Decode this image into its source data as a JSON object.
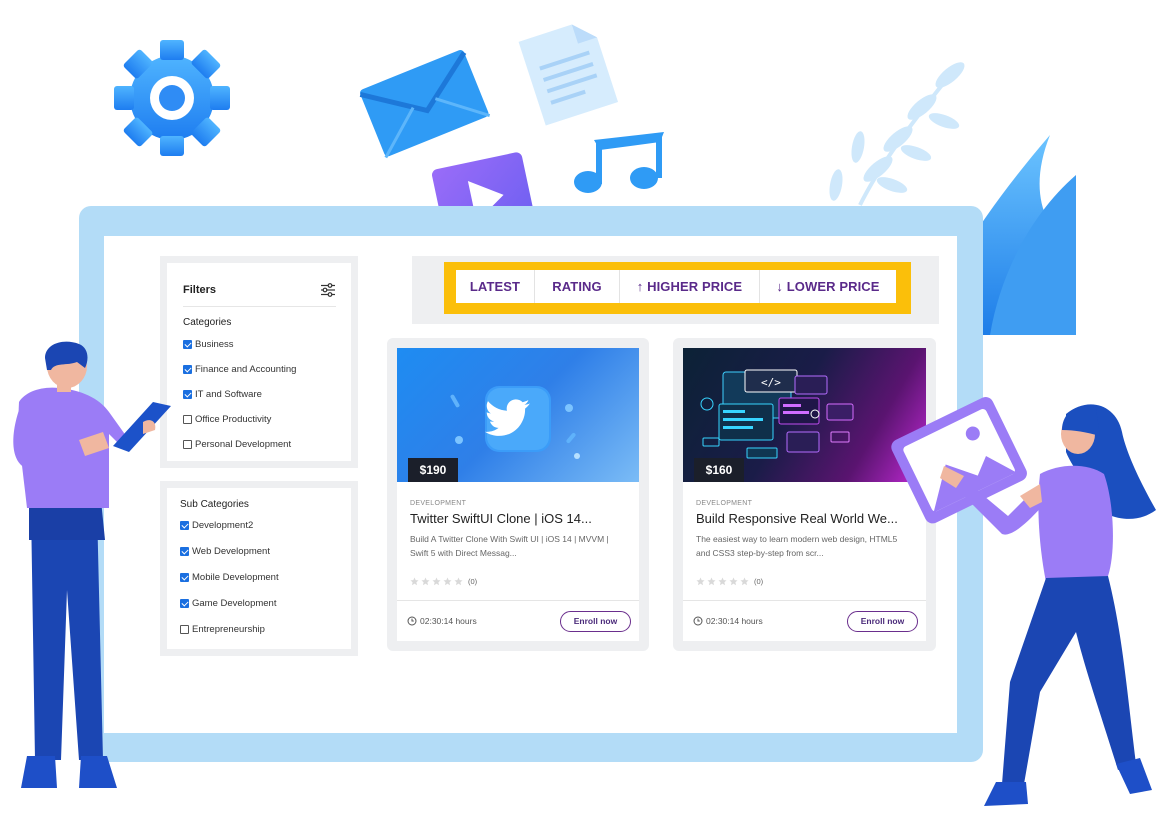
{
  "filters": {
    "title": "Filters",
    "settings_icon": "sliders-icon",
    "categories_title": "Categories",
    "categories": [
      {
        "label": "Business",
        "checked": true
      },
      {
        "label": "Finance and Accounting",
        "checked": true
      },
      {
        "label": "IT and Software",
        "checked": true
      },
      {
        "label": "Office Productivity",
        "checked": false
      },
      {
        "label": "Personal Development",
        "checked": false
      }
    ]
  },
  "sub_categories": {
    "title": "Sub Categories",
    "items": [
      {
        "label": "Development2",
        "checked": true
      },
      {
        "label": "Web Development",
        "checked": true
      },
      {
        "label": "Mobile Development",
        "checked": true
      },
      {
        "label": "Game Development",
        "checked": true
      },
      {
        "label": "Entrepreneurship",
        "checked": false
      }
    ]
  },
  "sort": {
    "tabs": [
      {
        "label": "LATEST",
        "active": true
      },
      {
        "label": "RATING",
        "active": false
      },
      {
        "label": "↑ HIGHER PRICE",
        "active": false
      },
      {
        "label": "↓ LOWER PRICE",
        "active": false
      }
    ],
    "accent": "#fbbf0a",
    "active_color": "#5f2b91"
  },
  "courses": [
    {
      "price": "$190",
      "category": "DEVELOPMENT",
      "title": "Twitter SwiftUI Clone | iOS 14...",
      "description": "Build A Twitter Clone With Swift UI | iOS 14 | MVVM | Swift 5 with Direct Messag...",
      "rating_count": "(0)",
      "stars": 0,
      "duration": "02:30:14 hours",
      "cta": "Enroll now"
    },
    {
      "price": "$160",
      "category": "DEVELOPMENT",
      "title": "Build Responsive Real World We...",
      "description": "The easiest way to learn modern web design, HTML5 and CSS3 step-by-step from scr...",
      "rating_count": "(0)",
      "stars": 0,
      "duration": "02:30:14 hours",
      "cta": "Enroll now"
    }
  ],
  "colors": {
    "monitor_frame": "#b3dcf7",
    "brand_blue": "#2f8cf5",
    "brand_purple": "#8b6cf6"
  }
}
